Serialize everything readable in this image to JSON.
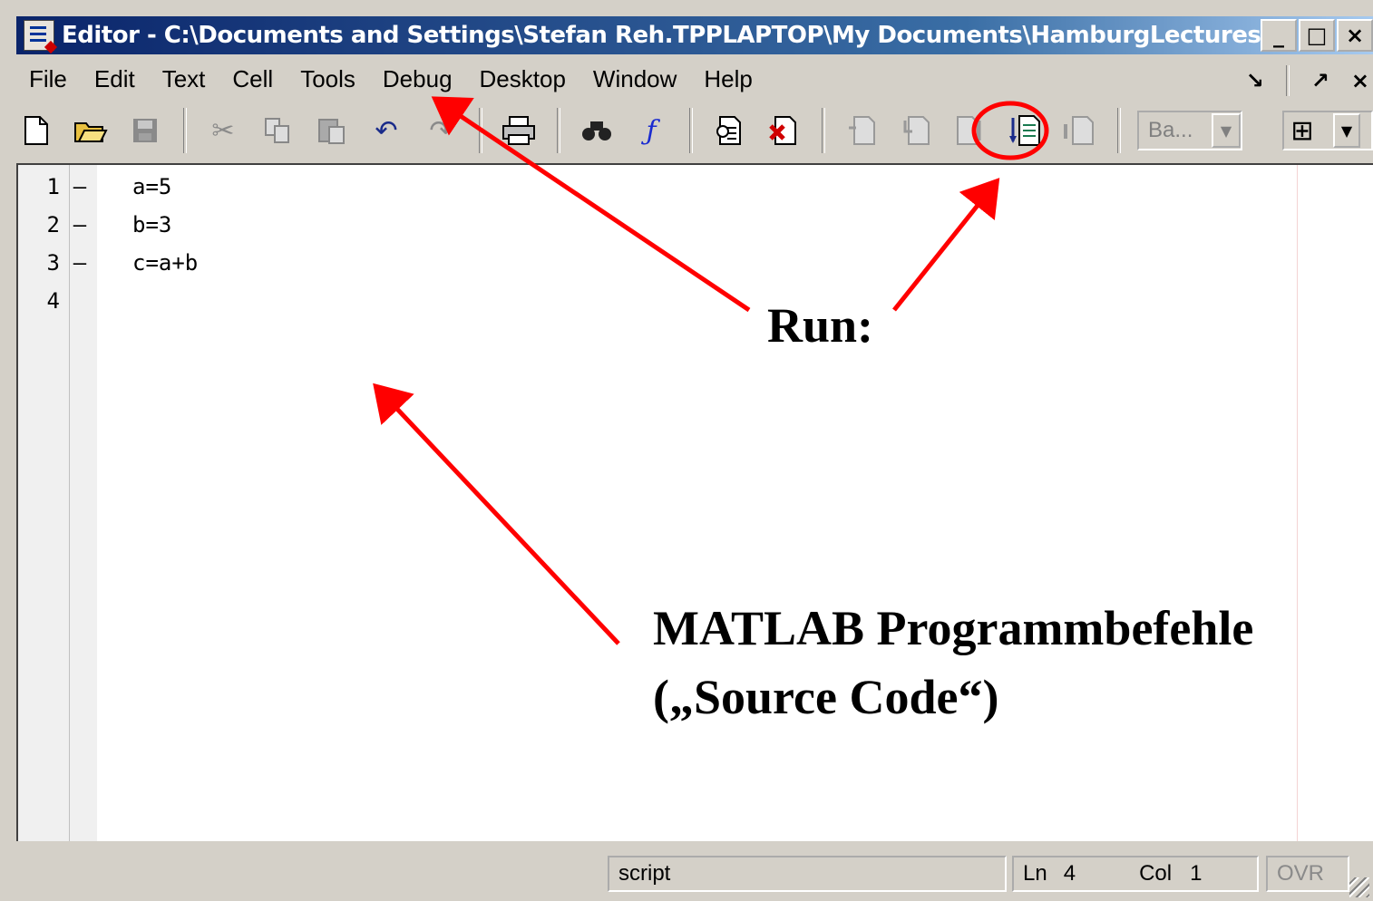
{
  "window": {
    "title": "Editor - C:\\Documents and Settings\\Stefan Reh.TPPLAPTOP\\My Documents\\HamburgLectures...",
    "buttons": {
      "minimize": "_",
      "maximize": "□",
      "close": "×"
    }
  },
  "menubar": {
    "items": [
      "File",
      "Edit",
      "Text",
      "Cell",
      "Tools",
      "Debug",
      "Desktop",
      "Window",
      "Help"
    ],
    "right": {
      "dock": "↘",
      "undock": "↗",
      "close": "×"
    }
  },
  "toolbar": {
    "icons": [
      "new-file-icon",
      "open-folder-icon",
      "save-icon",
      "cut-icon",
      "copy-icon",
      "paste-icon",
      "undo-icon",
      "redo-icon",
      "print-icon",
      "find-icon",
      "function-icon",
      "set-breakpoint-icon",
      "clear-breakpoint-icon",
      "step-icon",
      "step-in-icon",
      "step-out-icon",
      "run-icon",
      "exit-debug-icon",
      "grid-layout-icon"
    ],
    "stack_combo": "Ba..."
  },
  "editor": {
    "lines": [
      {
        "num": "1",
        "mark": "–",
        "code": "a=5"
      },
      {
        "num": "2",
        "mark": "–",
        "code": "b=3"
      },
      {
        "num": "3",
        "mark": "–",
        "code": "c=a+b"
      },
      {
        "num": "4",
        "mark": "",
        "code": ""
      }
    ]
  },
  "statusbar": {
    "type": "script",
    "ln_label": "Ln",
    "ln_value": "4",
    "col_label": "Col",
    "col_value": "1",
    "ovr": "OVR"
  },
  "annotations": {
    "run_label": "Run:",
    "source_label_line1": "MATLAB Programmbefehle",
    "source_label_line2": "(„Source Code“)",
    "arrow_color": "#ff0000"
  }
}
